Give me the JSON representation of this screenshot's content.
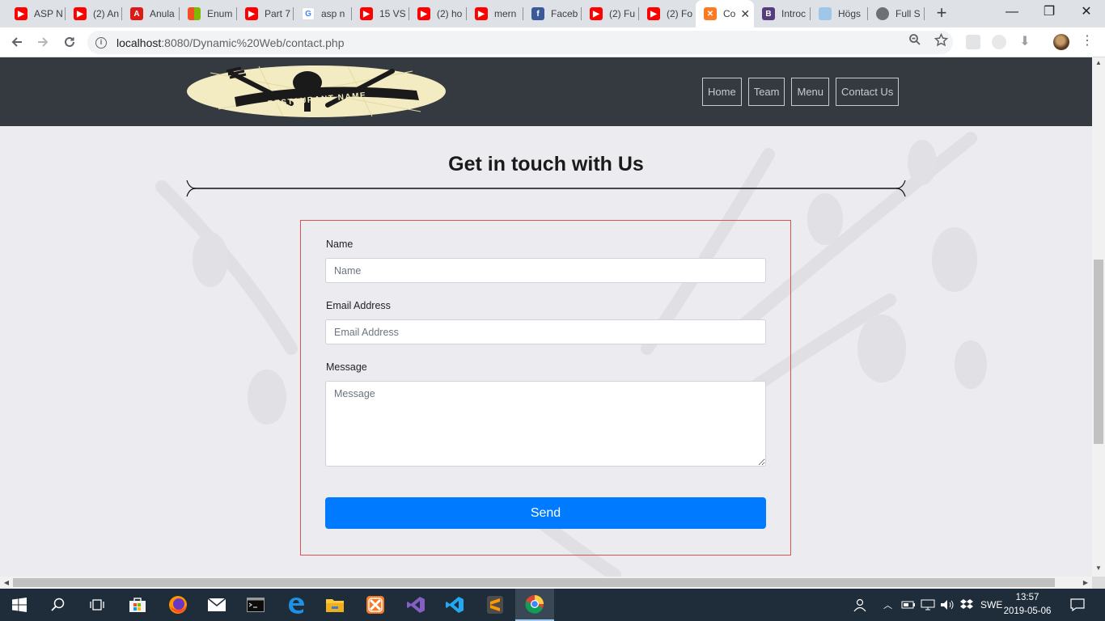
{
  "browser": {
    "tabs": [
      {
        "title": "ASP N",
        "icon": "youtube-icon"
      },
      {
        "title": "(2) An",
        "icon": "youtube-icon"
      },
      {
        "title": "Anula",
        "icon": "angular-icon"
      },
      {
        "title": "Enum",
        "icon": "microsoft-icon"
      },
      {
        "title": "Part 7",
        "icon": "youtube-icon"
      },
      {
        "title": "asp n",
        "icon": "google-icon"
      },
      {
        "title": "15 VS",
        "icon": "youtube-icon"
      },
      {
        "title": "(2) ho",
        "icon": "youtube-icon"
      },
      {
        "title": "mern",
        "icon": "youtube-icon"
      },
      {
        "title": "Faceb",
        "icon": "facebook-icon"
      },
      {
        "title": "(2) Fu",
        "icon": "youtube-icon"
      },
      {
        "title": "(2) Fo",
        "icon": "youtube-icon"
      },
      {
        "title": "Co",
        "icon": "xampp-icon"
      },
      {
        "title": "Introc",
        "icon": "bootstrap-icon"
      },
      {
        "title": "Högs",
        "icon": "cloud-icon"
      },
      {
        "title": "Full S",
        "icon": "globe-icon"
      }
    ],
    "new_tab": "+",
    "url_host": "localhost",
    "url_path": ":8080/Dynamic%20Web/contact.php"
  },
  "site": {
    "logo_text": "RESTAURANT NAME",
    "nav": [
      "Home",
      "Team",
      "Menu",
      "Contact Us"
    ]
  },
  "contact": {
    "heading": "Get in touch with Us",
    "name_label": "Name",
    "name_placeholder": "Name",
    "email_label": "Email Address",
    "email_placeholder": "Email Address",
    "message_label": "Message",
    "message_placeholder": "Message",
    "send_label": "Send"
  },
  "taskbar": {
    "apps": [
      "firefox-icon",
      "store-icon",
      "mail-icon",
      "terminal-icon",
      "edge-icon",
      "file-explorer-icon",
      "xampp-icon",
      "visual-studio-icon",
      "vscode-icon",
      "sublime-icon",
      "chrome-icon"
    ],
    "language": "SWE",
    "time": "13:57",
    "date": "2019-05-06"
  },
  "colors": {
    "header_bg": "#343a40",
    "send_button": "#007bff",
    "form_border": "#d9534f"
  }
}
